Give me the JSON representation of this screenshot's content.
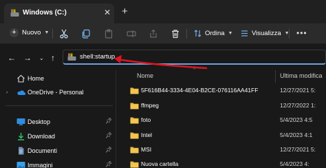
{
  "tab": {
    "title": "Windows (C:)",
    "close": "✕",
    "new_tab": "+"
  },
  "toolbar": {
    "new_label": "Nuovo",
    "sort_label": "Ordina",
    "view_label": "Visualizza",
    "more": "•••"
  },
  "address": {
    "path": "shell:startup"
  },
  "sidebar": {
    "items": [
      {
        "label": "Home"
      },
      {
        "label": "OneDrive - Personal"
      },
      {
        "label": "Desktop"
      },
      {
        "label": "Download"
      },
      {
        "label": "Documenti"
      },
      {
        "label": "Immagini"
      }
    ]
  },
  "columns": {
    "name": "Nome",
    "modified": "Ultima modifica"
  },
  "rows": [
    {
      "name": "5F616B44-3334-4E04-B2CE-076116AA41FF",
      "date": "12/27/2021 5:"
    },
    {
      "name": "ffmpeg",
      "date": "12/27/2022 1:"
    },
    {
      "name": "foto",
      "date": "5/4/2023 4:5"
    },
    {
      "name": "Intel",
      "date": "5/4/2023 4:1"
    },
    {
      "name": "MSI",
      "date": "12/27/2021 5:"
    },
    {
      "name": "Nuova cartella",
      "date": "5/4/2023 4:"
    }
  ],
  "colors": {
    "accent": "#6aa1e3",
    "folder": "#e8b840",
    "arrow": "#e0151f"
  }
}
